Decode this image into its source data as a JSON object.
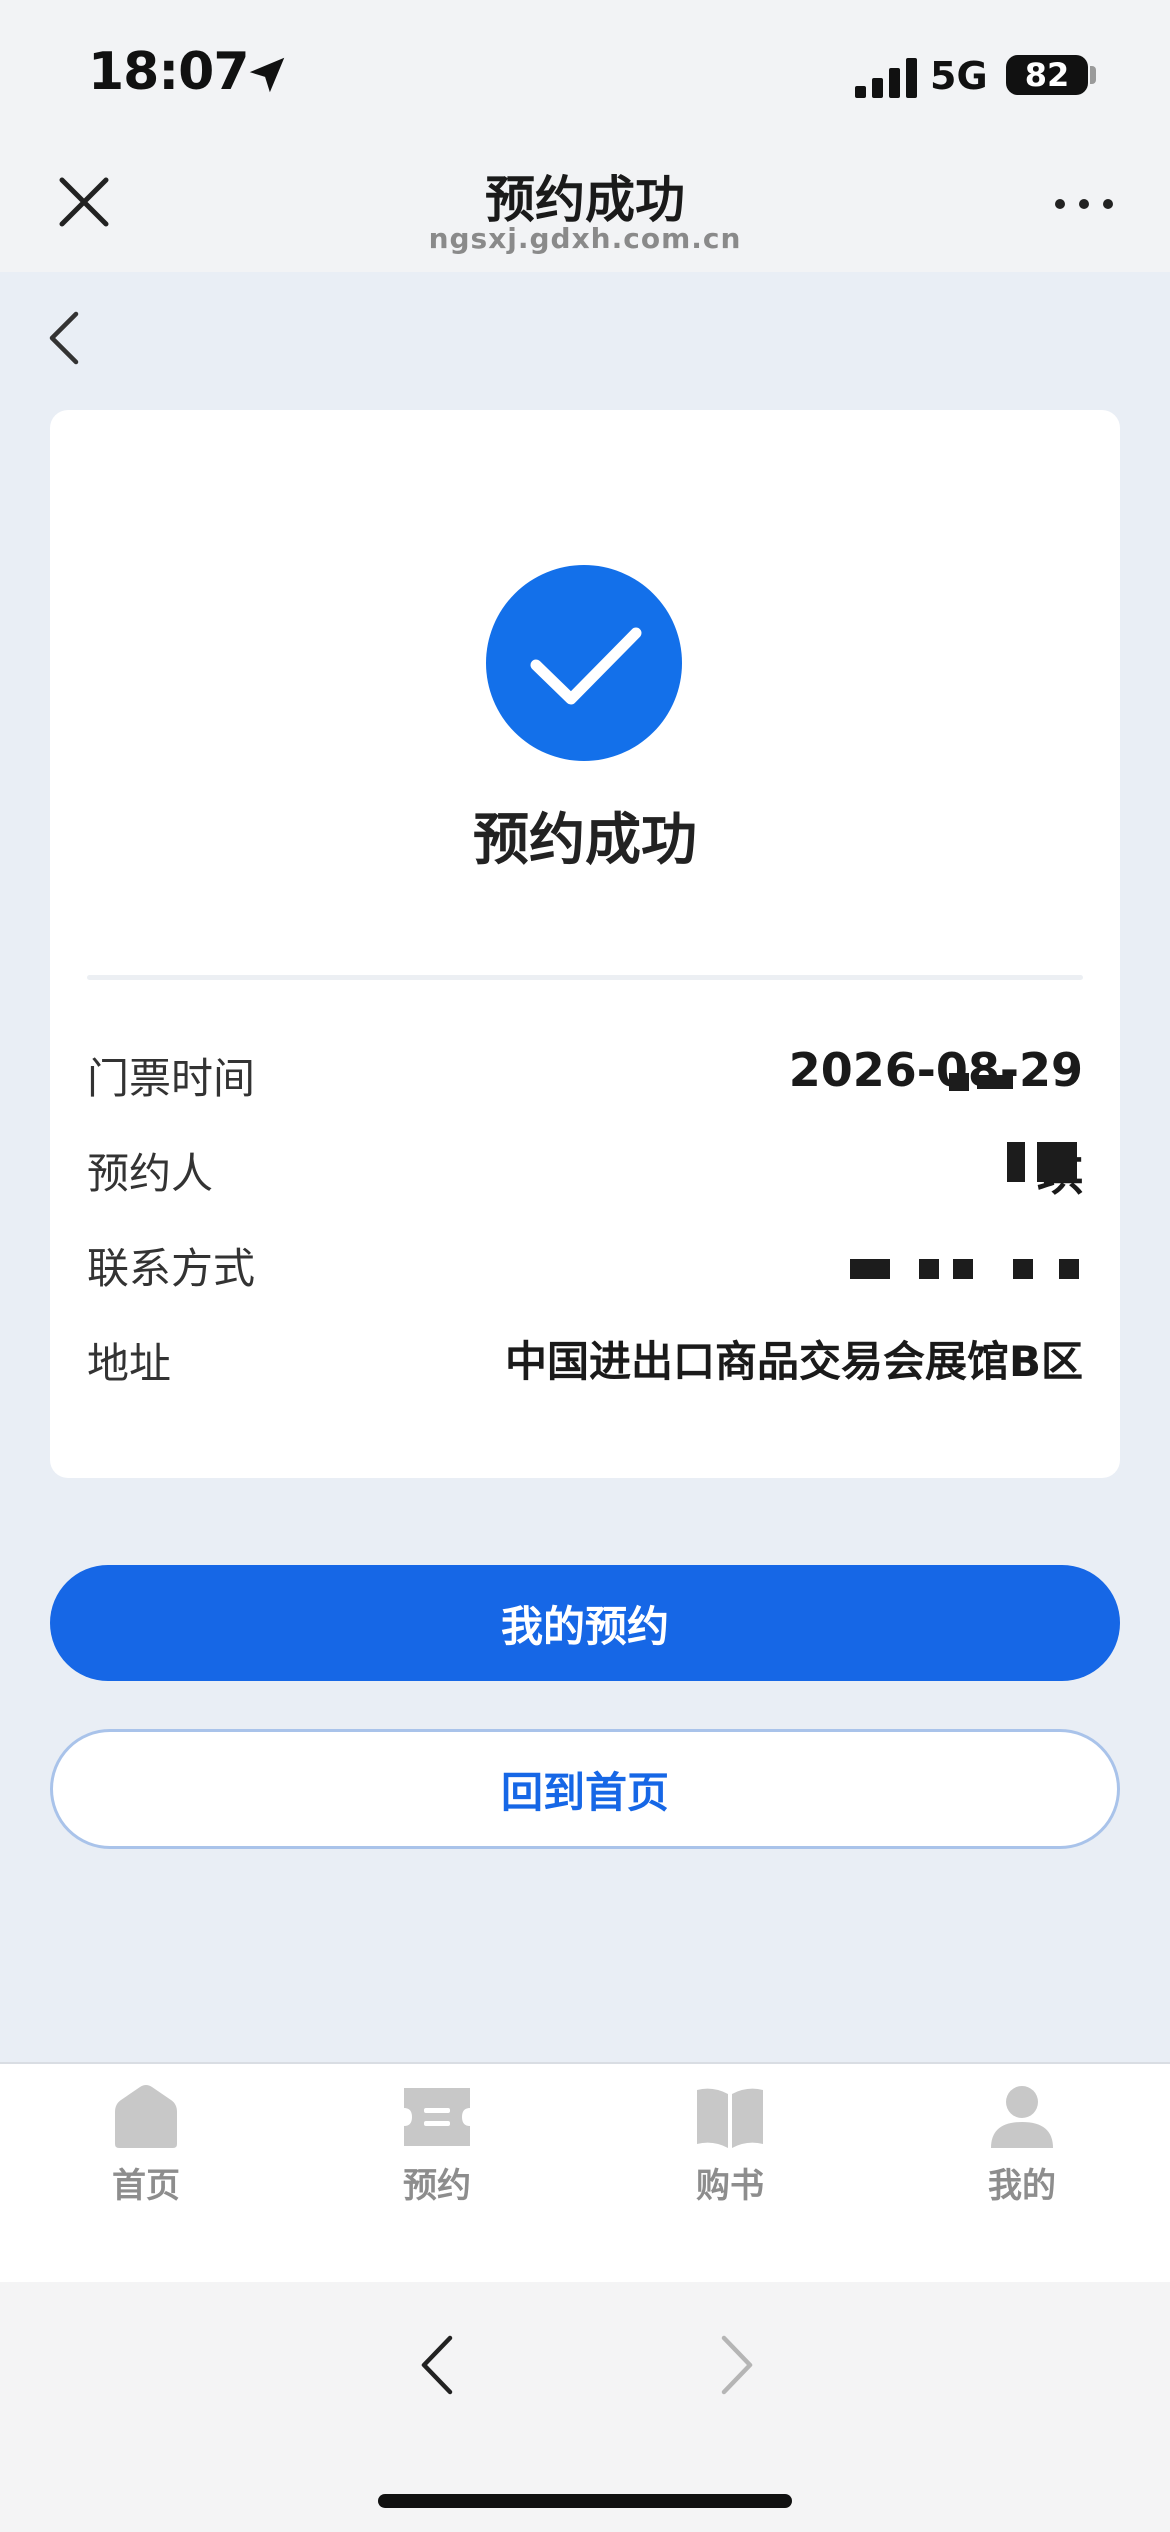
{
  "status_bar": {
    "time": "18:07",
    "network": "5G",
    "battery": "82"
  },
  "header": {
    "title": "预约成功",
    "url": "ngsxj.gdxh.com.cn"
  },
  "result": {
    "title": "预约成功"
  },
  "details": {
    "ticket_time_label": "门票时间",
    "ticket_time_value": "2026-08-29",
    "booker_label": "预约人",
    "booker_value": "琪",
    "contact_label": "联系方式",
    "contact_value": "",
    "address_label": "地址",
    "address_value": "中国进出口商品交易会展馆B区"
  },
  "buttons": {
    "my_booking": "我的预约",
    "back_home": "回到首页"
  },
  "tabbar": {
    "items": [
      {
        "label": "首页",
        "icon": "home-icon"
      },
      {
        "label": "预约",
        "icon": "ticket-icon"
      },
      {
        "label": "购书",
        "icon": "book-icon"
      },
      {
        "label": "我的",
        "icon": "user-icon"
      }
    ]
  },
  "colors": {
    "accent": "#1667e6",
    "page_bg": "#e9eef5",
    "tab_inactive": "#c8c8c8"
  }
}
